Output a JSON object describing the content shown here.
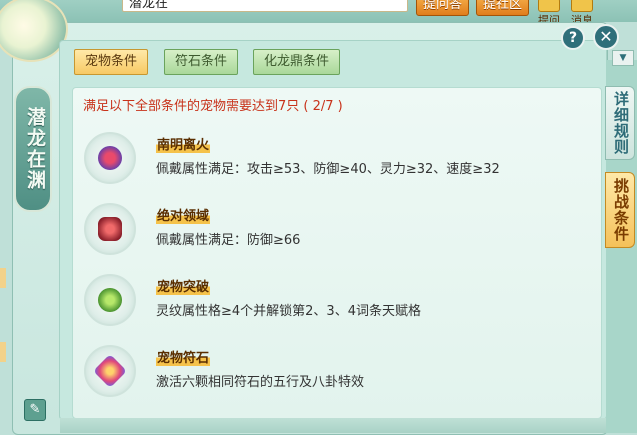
{
  "top": {
    "search_value": "潜龙在",
    "ask_button": "提问答",
    "community_button": "提社区",
    "help_label": "提问",
    "message_label": "消息"
  },
  "panel": {
    "side_title": "潜龙在渊",
    "tabs": [
      {
        "label": "宠物条件",
        "active": true
      },
      {
        "label": "符石条件",
        "active": false
      },
      {
        "label": "化龙鼎条件",
        "active": false
      }
    ],
    "summary": "满足以下全部条件的宠物需要达到7只 ( 2/7 )",
    "conditions": [
      {
        "name": "南明离火",
        "desc": "佩戴属性满足：攻击≥53、防御≥40、灵力≥32、速度≥32",
        "icon": "crown-ring-icon"
      },
      {
        "name": "绝对领域",
        "desc": "佩戴属性满足：防御≥66",
        "icon": "red-armor-icon"
      },
      {
        "name": "宠物突破",
        "desc": "灵纹属性格≥4个并解锁第2、3、4词条天赋格",
        "icon": "green-gourd-icon"
      },
      {
        "name": "宠物符石",
        "desc": "激活六颗相同符石的五行及八卦特效",
        "icon": "rune-stone-icon"
      }
    ]
  },
  "right_tabs": {
    "rules": "详细规则",
    "challenge": "挑战条件"
  },
  "colors": {
    "accent_red": "#c8321a",
    "active_tab": "#f7c964",
    "name_highlight": "#f5c24a"
  }
}
